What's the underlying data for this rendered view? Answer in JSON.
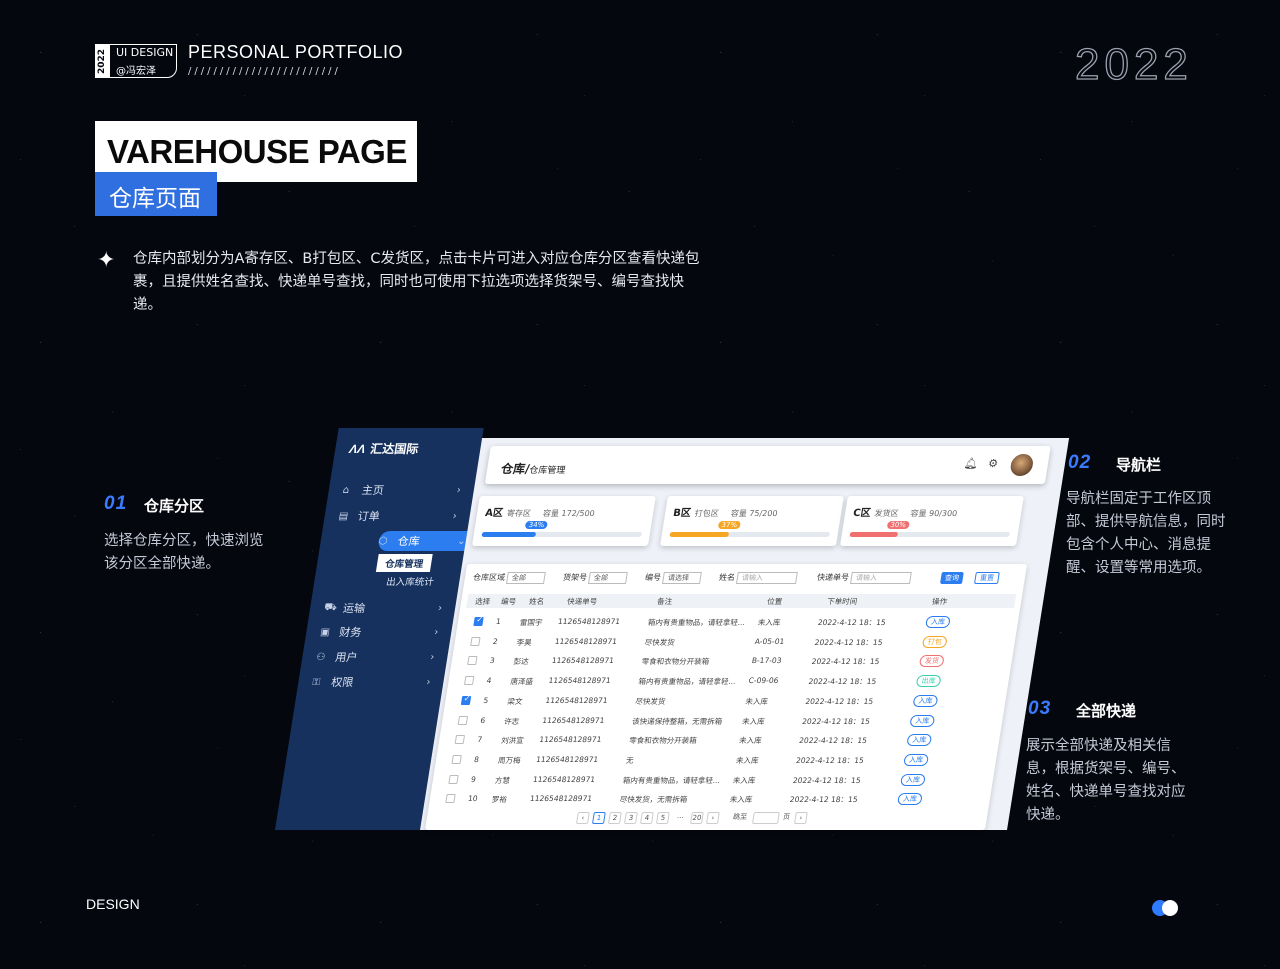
{
  "brand": {
    "year": "2022",
    "line1": "UI DESIGN",
    "line2": "@冯宏泽"
  },
  "header": {
    "portfolio": "PERSONAL PORTFOLIO",
    "slashes": "////////////////////////",
    "year": "2022"
  },
  "title": {
    "en": "VAREHOUSE PAGE",
    "cn": "仓库页面"
  },
  "intro": "仓库内部划分为A寄存区、B打包区、C发货区，点击卡片可进入对应仓库分区查看快递包裹，且提供姓名查找、快递单号查找，同时也可使用下拉选项选择货架号、编号查找快递。",
  "sections": [
    {
      "num": "01",
      "title": "仓库分区",
      "desc": "选择仓库分区，快速浏览该分区全部快递。"
    },
    {
      "num": "02",
      "title": "导航栏",
      "desc": "导航栏固定于工作区顶部、提供导航信息，同时包含个人中心、消息提醒、设置等常用选项。"
    },
    {
      "num": "03",
      "title": "全部快递",
      "desc": "展示全部快递及相关信息，根据货架号、编号、姓名、快递单号查找对应快递。"
    }
  ],
  "footer": {
    "design": "DESIGN"
  },
  "app": {
    "logo": "汇达国际",
    "logo_mark": "ΛΛ",
    "nav": [
      {
        "label": "主页",
        "icon": "home-icon",
        "glyph": "⌂"
      },
      {
        "label": "订单",
        "icon": "order-icon",
        "glyph": "▤"
      },
      {
        "label": "仓库",
        "icon": "warehouse-icon",
        "glyph": "⬡"
      },
      {
        "label": "运输",
        "icon": "truck-icon",
        "glyph": "⛟"
      },
      {
        "label": "财务",
        "icon": "finance-icon",
        "glyph": "▣"
      },
      {
        "label": "用户",
        "icon": "user-icon",
        "glyph": "⚇"
      },
      {
        "label": "权限",
        "icon": "lock-icon",
        "glyph": "⚿"
      }
    ],
    "sub_nav": [
      "仓库管理",
      "出入库统计"
    ],
    "breadcrumb": {
      "main": "仓库/",
      "sub": "仓库管理"
    },
    "cards": [
      {
        "zone": "A区",
        "name": "寄存区",
        "capacity": "容量 172/500",
        "percent_label": "34%",
        "percent": 34,
        "color": "#2b7df0"
      },
      {
        "zone": "B区",
        "name": "打包区",
        "capacity": "容量 75/200",
        "percent_label": "37%",
        "percent": 37,
        "color": "#f5a623"
      },
      {
        "zone": "C区",
        "name": "发货区",
        "capacity": "容量 90/300",
        "percent_label": "30%",
        "percent": 30,
        "color": "#f07070"
      }
    ],
    "filters": {
      "area_label": "仓库区域",
      "area_value": "全部",
      "shelf_label": "货架号",
      "shelf_value": "全部",
      "num_label": "编号",
      "num_value": "请选择",
      "name_label": "姓名",
      "name_placeholder": "请输入",
      "track_label": "快递单号",
      "track_placeholder": "请输入",
      "query": "查询",
      "reset": "重置"
    },
    "columns": [
      "选择",
      "编号",
      "姓名",
      "快递单号",
      "备注",
      "位置",
      "下单时间",
      "操作"
    ],
    "rows": [
      {
        "checked": true,
        "no": "1",
        "name": "雷国宇",
        "track": "1126548128971",
        "note": "箱内有贵重物品，请轻拿轻...",
        "loc": "未入库",
        "time": "2022-4-12  18：15",
        "action": "入库",
        "color": "#2b7df0"
      },
      {
        "checked": false,
        "no": "2",
        "name": "李昊",
        "track": "1126548128971",
        "note": "尽快发货",
        "loc": "A-05-01",
        "time": "2022-4-12  18：15",
        "action": "打包",
        "color": "#f5a623"
      },
      {
        "checked": false,
        "no": "3",
        "name": "彭达",
        "track": "1126548128971",
        "note": "零食和衣物分开装箱",
        "loc": "B-17-03",
        "time": "2022-4-12  18：15",
        "action": "发货",
        "color": "#f07070"
      },
      {
        "checked": false,
        "no": "4",
        "name": "唐泽盛",
        "track": "1126548128971",
        "note": "箱内有贵重物品，请轻拿轻...",
        "loc": "C-09-06",
        "time": "2022-4-12  18：15",
        "action": "出库",
        "color": "#3ccfb0"
      },
      {
        "checked": true,
        "no": "5",
        "name": "梁文",
        "track": "1126548128971",
        "note": "尽快发货",
        "loc": "未入库",
        "time": "2022-4-12  18：15",
        "action": "入库",
        "color": "#2b7df0"
      },
      {
        "checked": false,
        "no": "6",
        "name": "许志",
        "track": "1126548128971",
        "note": "该快递保持整箱，无需拆箱",
        "loc": "未入库",
        "time": "2022-4-12  18：15",
        "action": "入库",
        "color": "#2b7df0"
      },
      {
        "checked": false,
        "no": "7",
        "name": "刘洪宣",
        "track": "1126548128971",
        "note": "零食和衣物分开装箱",
        "loc": "未入库",
        "time": "2022-4-12  18：15",
        "action": "入库",
        "color": "#2b7df0"
      },
      {
        "checked": false,
        "no": "8",
        "name": "周万梅",
        "track": "1126548128971",
        "note": "无",
        "loc": "未入库",
        "time": "2022-4-12  18：15",
        "action": "入库",
        "color": "#2b7df0"
      },
      {
        "checked": false,
        "no": "9",
        "name": "方慧",
        "track": "1126548128971",
        "note": "箱内有贵重物品，请轻拿轻...",
        "loc": "未入库",
        "time": "2022-4-12  18：15",
        "action": "入库",
        "color": "#2b7df0"
      },
      {
        "checked": false,
        "no": "10",
        "name": "罗裕",
        "track": "1126548128971",
        "note": "尽快发货，无需拆箱",
        "loc": "未入库",
        "time": "2022-4-12  18：15",
        "action": "入库",
        "color": "#2b7df0"
      }
    ],
    "pager": {
      "prev": "‹",
      "pages": [
        "1",
        "2",
        "3",
        "4",
        "5"
      ],
      "dots": "...",
      "last": "20",
      "next": "›",
      "jump_label": "跳至",
      "jump_unit": "页"
    }
  }
}
